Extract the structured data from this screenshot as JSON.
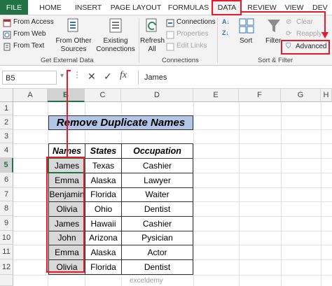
{
  "tabs": [
    {
      "label": "FILE"
    },
    {
      "label": "HOME"
    },
    {
      "label": "INSERT"
    },
    {
      "label": "PAGE LAYOUT"
    },
    {
      "label": "FORMULAS"
    },
    {
      "label": "DATA"
    },
    {
      "label": "REVIEW"
    },
    {
      "label": "VIEW"
    },
    {
      "label": "DEV"
    }
  ],
  "ribbon": {
    "from_access": "From Access",
    "from_web": "From Web",
    "from_text": "From Text",
    "from_other_1": "From Other",
    "from_other_2": "Sources",
    "existing_1": "Existing",
    "existing_2": "Connections",
    "refresh_1": "Refresh",
    "refresh_2": "All",
    "connections": "Connections",
    "properties": "Properties",
    "edit_links": "Edit Links",
    "sort": "Sort",
    "filter": "Filter",
    "clear": "Clear",
    "reapply": "Reapply",
    "advanced": "Advanced",
    "group_external": "Get External Data",
    "group_connections": "Connections",
    "group_sortfilter": "Sort & Filter"
  },
  "formula_bar": {
    "name_box": "B5",
    "fx": "fx",
    "value": "James"
  },
  "columns": [
    "A",
    "B",
    "C",
    "D",
    "E",
    "F",
    "G",
    "H"
  ],
  "rows": [
    "1",
    "2",
    "3",
    "4",
    "5",
    "6",
    "7",
    "8",
    "9",
    "10",
    "11",
    "12"
  ],
  "sheet": {
    "title": "Remove Duplicate Names",
    "headers": [
      "Names",
      "States",
      "Occupation"
    ],
    "records": [
      [
        "James",
        "Texas",
        "Cashier"
      ],
      [
        "Emma",
        "Alaska",
        "Lawyer"
      ],
      [
        "Benjamin",
        "Florida",
        "Waiter"
      ],
      [
        "Olivia",
        "Ohio",
        "Dentist"
      ],
      [
        "James",
        "Hawaii",
        "Cashier"
      ],
      [
        "John",
        "Arizona",
        "Pysician"
      ],
      [
        "Emma",
        "Alaska",
        "Actor"
      ],
      [
        "Olivia",
        "Florida",
        "Dentist"
      ]
    ]
  },
  "watermark": "exceldemy",
  "colors": {
    "excel_green": "#217346",
    "title_fill": "#b4c6e7",
    "highlight_red": "#e8192c",
    "name_shade": "#d9d9d9"
  }
}
